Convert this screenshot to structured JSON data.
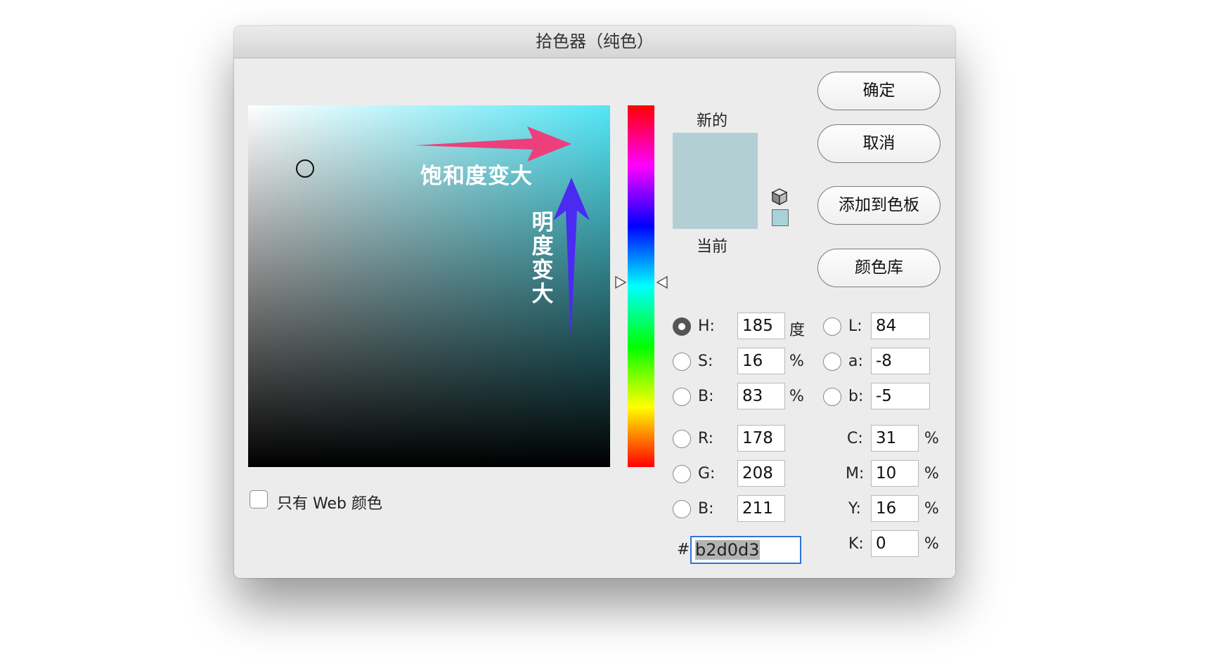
{
  "window": {
    "title": "拾色器（纯色）"
  },
  "field": {
    "saturation_annotation": "饱和度变大",
    "brightness_annotation": [
      "明",
      "度",
      "变",
      "大"
    ],
    "annotation_arrow_colors": {
      "horizontal": "#ec3f7c",
      "vertical": "#4a2bf2"
    }
  },
  "preview": {
    "new_label": "新的",
    "current_label": "当前",
    "new_color": "#b2d0d3",
    "current_color": "#b2d0d3",
    "gamut_icon": "cube-icon",
    "websafe_color": "#a7d2d8"
  },
  "buttons": {
    "ok": "确定",
    "cancel": "取消",
    "add_swatch": "添加到色板",
    "color_libraries": "颜色库"
  },
  "hsb": {
    "h": {
      "label": "H:",
      "value": "185",
      "unit": "度",
      "selected": true
    },
    "s": {
      "label": "S:",
      "value": "16",
      "unit": "%"
    },
    "b": {
      "label": "B:",
      "value": "83",
      "unit": "%"
    }
  },
  "rgb": {
    "r": {
      "label": "R:",
      "value": "178"
    },
    "g": {
      "label": "G:",
      "value": "208"
    },
    "b": {
      "label": "B:",
      "value": "211"
    }
  },
  "lab": {
    "l": {
      "label": "L:",
      "value": "84"
    },
    "a": {
      "label": "a:",
      "value": "-8"
    },
    "b": {
      "label": "b:",
      "value": "-5"
    }
  },
  "cmyk": {
    "c": {
      "label": "C:",
      "value": "31",
      "unit": "%"
    },
    "m": {
      "label": "M:",
      "value": "10",
      "unit": "%"
    },
    "y": {
      "label": "Y:",
      "value": "16",
      "unit": "%"
    },
    "k": {
      "label": "K:",
      "value": "0",
      "unit": "%"
    }
  },
  "hex": {
    "label": "#",
    "value": "b2d0d3"
  },
  "web_only": {
    "label": "只有 Web 颜色",
    "checked": false
  }
}
